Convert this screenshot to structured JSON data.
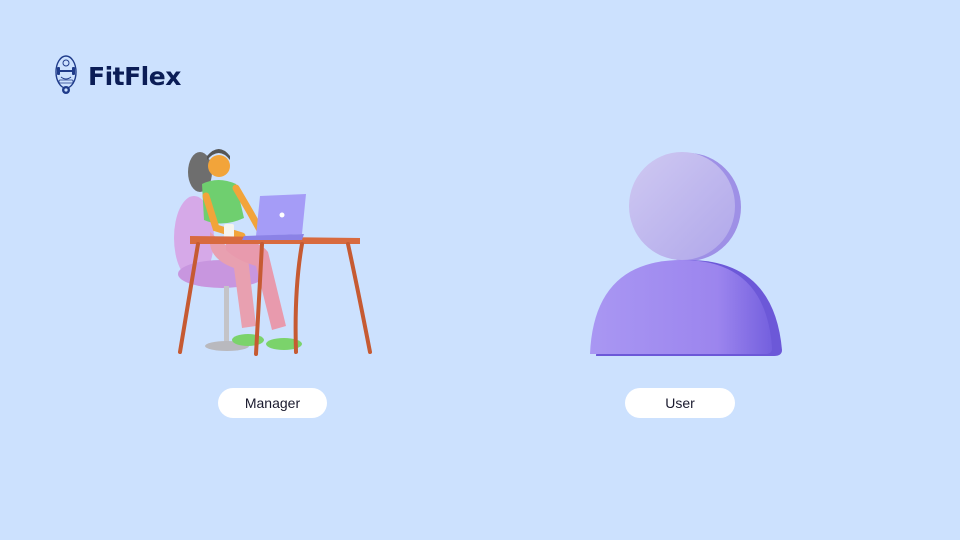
{
  "brand": {
    "name": "FitFlex",
    "logo_icon": "dumbbell-badge-icon",
    "colors": {
      "background": "#cce1fe",
      "brand_text": "#0b1d56",
      "button_bg": "#ffffff",
      "accent_purple": "#a08af0"
    }
  },
  "roles": [
    {
      "id": "manager",
      "label": "Manager",
      "illustration": "person-at-desk-with-laptop-illustration"
    },
    {
      "id": "user",
      "label": "User",
      "illustration": "user-silhouette-3d-icon"
    }
  ]
}
